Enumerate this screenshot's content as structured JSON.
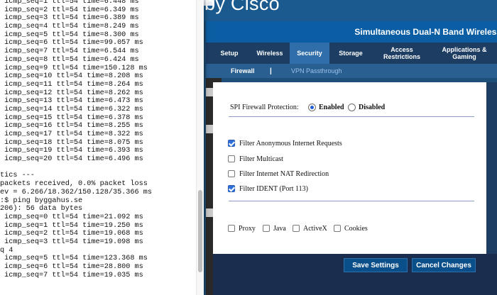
{
  "router": {
    "brand": "by Cisco",
    "product_name": "Simultaneous Dual-N Band Wireless",
    "tabs": [
      {
        "label": "Setup",
        "active": false
      },
      {
        "label": "Wireless",
        "active": false
      },
      {
        "label": "Security",
        "active": true
      },
      {
        "label": "Storage",
        "active": false
      },
      {
        "label": "Access Restrictions",
        "active": false
      },
      {
        "label": "Applications & Gaming",
        "active": false
      }
    ],
    "subtabs": [
      {
        "label": "Firewall",
        "active": true
      },
      {
        "label": "VPN Passthrough",
        "active": false
      }
    ],
    "subtab_separator": "|",
    "firewall": {
      "spi_label": "SPI Firewall Protection:",
      "spi_options": [
        {
          "label": "Enabled",
          "selected": true
        },
        {
          "label": "Disabled",
          "selected": false
        }
      ],
      "filters": [
        {
          "label": "Filter Anonymous Internet Requests",
          "checked": true
        },
        {
          "label": "Filter Multicast",
          "checked": false
        },
        {
          "label": "Filter Internet NAT Redirection",
          "checked": false
        },
        {
          "label": "Filter IDENT (Port 113)",
          "checked": true
        }
      ],
      "web_filters": [
        {
          "label": "Proxy",
          "checked": false
        },
        {
          "label": "Java",
          "checked": false
        },
        {
          "label": "ActiveX",
          "checked": false
        },
        {
          "label": "Cookies",
          "checked": false
        }
      ]
    },
    "buttons": {
      "save": "Save Settings",
      "cancel": "Cancel Changes"
    },
    "colors": {
      "accent": "#0b5ea3",
      "nav": "#1d3d63",
      "active_tab": "#2f6ea8"
    }
  },
  "terminal": {
    "lines": [
      " icmp_seq=1 ttl=54 time=6.448 ms",
      " icmp_seq=2 ttl=54 time=6.349 ms",
      " icmp_seq=3 ttl=54 time=6.389 ms",
      " icmp_seq=4 ttl=54 time=8.249 ms",
      " icmp_seq=5 ttl=54 time=8.300 ms",
      " icmp_seq=6 ttl=54 time=99.057 ms",
      " icmp_seq=7 ttl=54 time=6.544 ms",
      " icmp_seq=8 ttl=54 time=6.424 ms",
      " icmp_seq=9 ttl=54 time=150.128 ms",
      " icmp_seq=10 ttl=54 time=8.208 ms",
      " icmp_seq=11 ttl=54 time=8.264 ms",
      " icmp_seq=12 ttl=54 time=8.262 ms",
      " icmp_seq=13 ttl=54 time=6.473 ms",
      " icmp_seq=14 ttl=54 time=6.322 ms",
      " icmp_seq=15 ttl=54 time=6.378 ms",
      " icmp_seq=16 ttl=54 time=8.255 ms",
      " icmp_seq=17 ttl=54 time=8.322 ms",
      " icmp_seq=18 ttl=54 time=8.075 ms",
      " icmp_seq=19 ttl=54 time=6.393 ms",
      " icmp_seq=20 ttl=54 time=6.496 ms",
      "",
      "tics ---",
      "packets received, 0.0% packet loss",
      "ev = 6.266/18.362/150.128/35.366 ms",
      ":$ ping byggahus.se",
      "206): 56 data bytes",
      " icmp_seq=0 ttl=54 time=21.092 ms",
      " icmp_seq=1 ttl=54 time=19.250 ms",
      " icmp_seq=2 ttl=54 time=19.068 ms",
      " icmp_seq=3 ttl=54 time=19.098 ms",
      "q 4",
      " icmp_seq=5 ttl=54 time=123.368 ms",
      " icmp_seq=6 ttl=54 time=28.800 ms",
      " icmp_seq=7 ttl=54 time=19.035 ms"
    ]
  }
}
